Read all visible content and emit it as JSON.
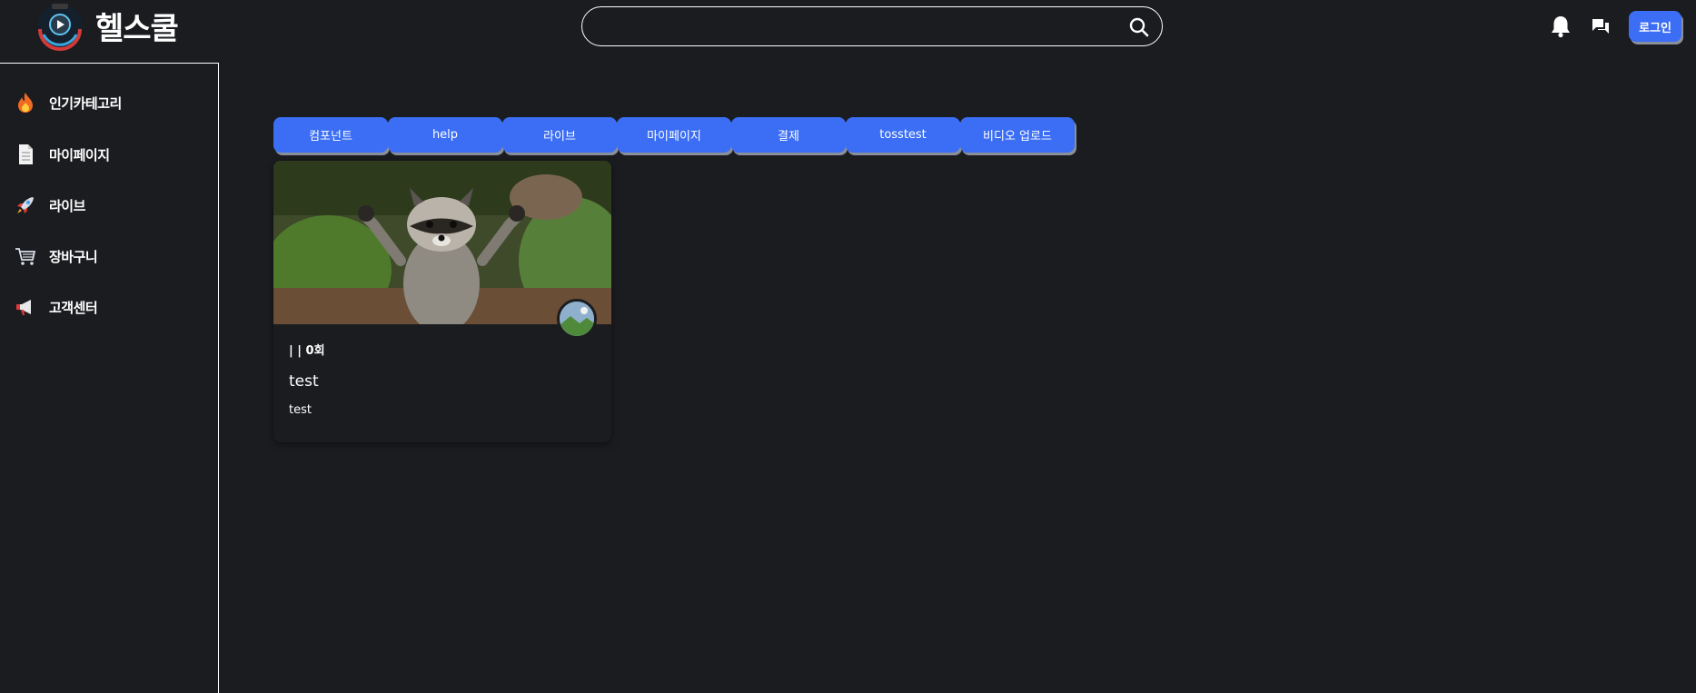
{
  "header": {
    "logo_text": "헬스쿨",
    "search": {
      "value": "",
      "placeholder": ""
    },
    "login_label": "로그인"
  },
  "sidebar": {
    "items": [
      {
        "label": "인기카테고리",
        "icon": "fire-icon"
      },
      {
        "label": "마이페이지",
        "icon": "document-icon"
      },
      {
        "label": "라이브",
        "icon": "rocket-icon"
      },
      {
        "label": "장바구니",
        "icon": "cart-icon"
      },
      {
        "label": "고객센터",
        "icon": "megaphone-icon"
      }
    ]
  },
  "tabs": [
    "컴포넌트",
    "help",
    "라이브",
    "마이페이지",
    "결제",
    "tosstest",
    "비디오 업로드"
  ],
  "cards": [
    {
      "meta": "| | 0회",
      "title": "test",
      "description": "test",
      "thumbnail": "raccoon-photo"
    }
  ],
  "colors": {
    "background": "#1b1c20",
    "accent": "#3b6ef5",
    "text": "#ffffff"
  }
}
